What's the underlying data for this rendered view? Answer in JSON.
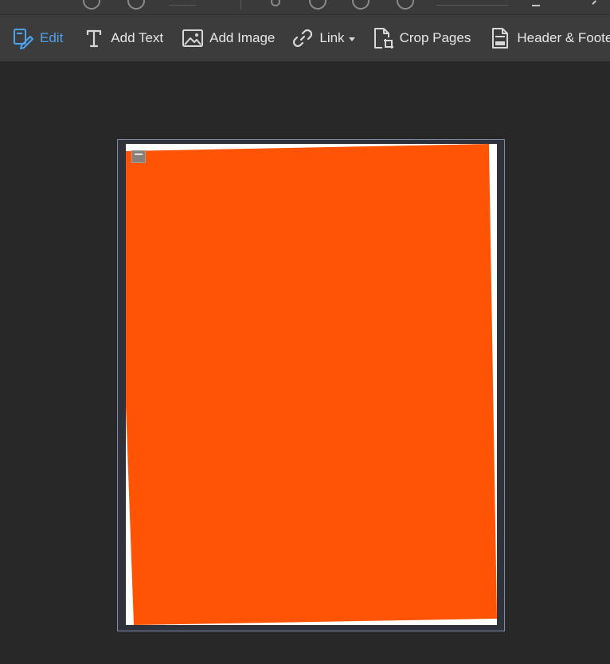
{
  "toolbar": {
    "items": [
      {
        "label": "Edit",
        "icon": "edit-icon",
        "active": true
      },
      {
        "label": "Add Text",
        "icon": "text-icon"
      },
      {
        "label": "Add Image",
        "icon": "image-icon"
      },
      {
        "label": "Link",
        "icon": "link-icon",
        "has_dropdown": true
      },
      {
        "label": "Crop Pages",
        "icon": "crop-pages-icon"
      },
      {
        "label": "Header & Footer",
        "icon": "header-footer-icon"
      }
    ]
  },
  "document": {
    "image_color": "#ff5405",
    "page_color": "#ffffff",
    "selection_border_color": "#7e8aa6"
  },
  "colors": {
    "active": "#4ea3f0",
    "toolbar_bg": "#3c3c3c",
    "canvas_bg": "#282828"
  }
}
